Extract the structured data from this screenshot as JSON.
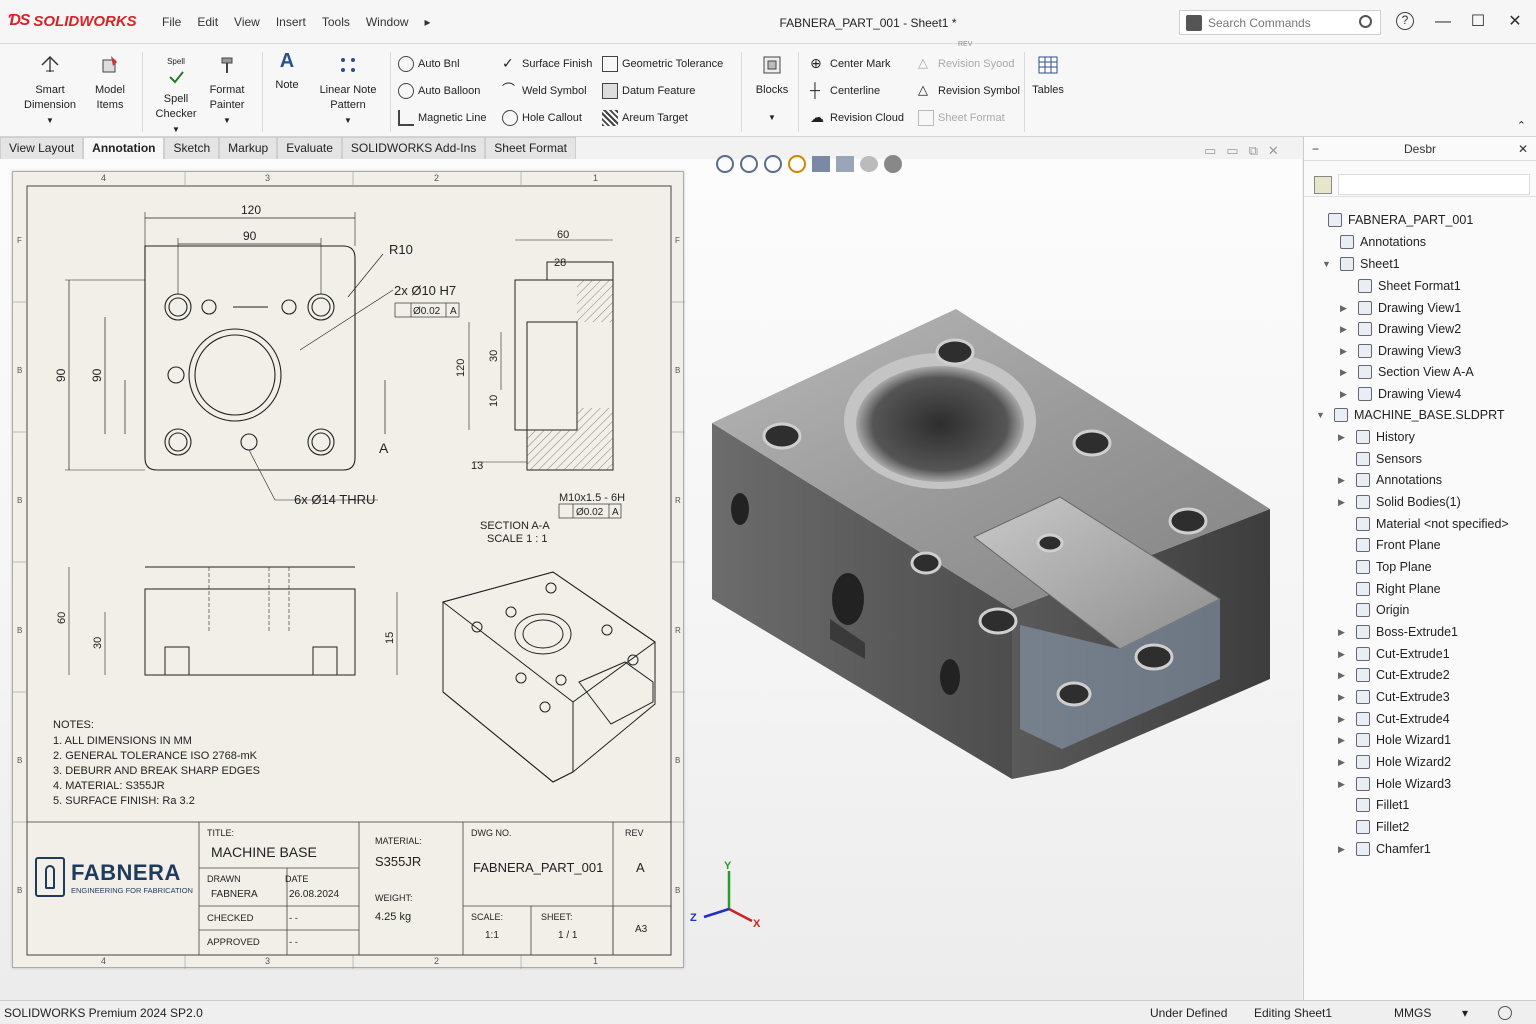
{
  "app": {
    "brand": "SOLIDWORKS",
    "doc_title": "FABNERA_PART_001 - Sheet1 *"
  },
  "menu": [
    "File",
    "Edit",
    "View",
    "Insert",
    "Tools",
    "Window"
  ],
  "search": {
    "placeholder": "Search Commands"
  },
  "ribbon": {
    "smart_dimension": [
      "Smart",
      "Dimension"
    ],
    "model_items": [
      "Model",
      "Items"
    ],
    "spell_checker": [
      "Spell",
      "Checker"
    ],
    "spell_badge": "Spell",
    "format_painter": [
      "Format",
      "Painter"
    ],
    "note": "Note",
    "linear_note_pattern": [
      "Linear Note",
      "Pattern"
    ],
    "auto_balloon_top": "Auto Bnl",
    "auto_balloon": "Auto Balloon",
    "magnetic_line": "Magnetic Line",
    "surface_finish": "Surface Finish",
    "weld_symbol": "Weld Symbol",
    "hole_callout": "Hole Callout",
    "geometric_tolerance": "Geometric Tolerance",
    "datum_feature": "Datum Feature",
    "datum_target": "Areum Target",
    "blocks": "Blocks",
    "center_mark": "Center Mark",
    "centerline": "Centerline",
    "revision_cloud": "Revision Cloud",
    "revision_symbol_disabled": "Revision Syood",
    "revision_symbol": "Revision Symbol",
    "sheet_format": "Sheet Format",
    "rev_badge": "REV",
    "tables": "Tables"
  },
  "tabs": [
    "View Layout",
    "Annotation",
    "Sketch",
    "Markup",
    "Evaluate",
    "SOLIDWORKS Add-Ins",
    "Sheet Format"
  ],
  "tree": {
    "header": "Desbr",
    "items": [
      {
        "label": "FABNERA_PART_001",
        "arrow": ""
      },
      {
        "label": "Annotations",
        "arrow": ""
      },
      {
        "label": "Sheet1",
        "arrow": "▼"
      },
      {
        "label": "Sheet Format1",
        "arrow": ""
      },
      {
        "label": "Drawing View1",
        "arrow": "▶"
      },
      {
        "label": "Drawing View2",
        "arrow": "▶"
      },
      {
        "label": "Drawing View3",
        "arrow": "▶"
      },
      {
        "label": "Section View A-A",
        "arrow": "▶"
      },
      {
        "label": "Drawing View4",
        "arrow": "▶"
      },
      {
        "label": "MACHINE_BASE.SLDPRT",
        "arrow": "▼"
      },
      {
        "label": "History",
        "arrow": "▶"
      },
      {
        "label": "Sensors",
        "arrow": ""
      },
      {
        "label": "Annotations",
        "arrow": "▶"
      },
      {
        "label": "Solid Bodies(1)",
        "arrow": "▶"
      },
      {
        "label": "Material <not specified>",
        "arrow": ""
      },
      {
        "label": "Front Plane",
        "arrow": ""
      },
      {
        "label": "Top Plane",
        "arrow": ""
      },
      {
        "label": "Right Plane",
        "arrow": ""
      },
      {
        "label": "Origin",
        "arrow": ""
      },
      {
        "label": "Boss-Extrude1",
        "arrow": "▶"
      },
      {
        "label": "Cut-Extrude1",
        "arrow": "▶"
      },
      {
        "label": "Cut-Extrude2",
        "arrow": "▶"
      },
      {
        "label": "Cut-Extrude3",
        "arrow": "▶"
      },
      {
        "label": "Cut-Extrude4",
        "arrow": "▶"
      },
      {
        "label": "Hole Wizard1",
        "arrow": "▶"
      },
      {
        "label": "Hole Wizard2",
        "arrow": "▶"
      },
      {
        "label": "Hole Wizard3",
        "arrow": "▶"
      },
      {
        "label": "Fillet1",
        "arrow": ""
      },
      {
        "label": "Fillet2",
        "arrow": ""
      },
      {
        "label": "Chamfer1",
        "arrow": "▶"
      }
    ]
  },
  "drawing": {
    "zones_top": [
      "4",
      "3",
      "2",
      "1"
    ],
    "zones_side": [
      "F",
      "B",
      "B",
      "B",
      "B",
      "B"
    ],
    "zones_side_right": [
      "F",
      "B",
      "R",
      "R",
      "B",
      "B"
    ],
    "dims": {
      "d120": "120",
      "d90": "90",
      "r10": "R10",
      "holes_h7": "2x Ø10 H7",
      "tol_pos": "Ø0.02",
      "datum_a": "A",
      "v90a": "90",
      "v90b": "90",
      "section_label": "A",
      "thru": "6x Ø14 THRU",
      "d60": "60",
      "d28": "28",
      "d30v": "30",
      "d120v": "120",
      "d13": "13",
      "d10v": "10",
      "m10": "M10x1.5 - 6H",
      "tol2": "Ø0.02",
      "section_title": "SECTION A-A",
      "section_scale": "SCALE 1 : 1",
      "f60": "60",
      "f30": "30",
      "f15": "15"
    },
    "notes_title": "NOTES:",
    "notes": [
      "1. ALL DIMENSIONS IN MM",
      "2. GENERAL TOLERANCE ISO 2768-mK",
      "3. DEBURR AND BREAK SHARP EDGES",
      "4. MATERIAL: S355JR",
      "5. SURFACE FINISH: Ra 3.2"
    ],
    "title_block": {
      "company": "FABNERA",
      "tagline": "ENGINEERING FOR FABRICATION",
      "title_label": "TITLE:",
      "title": "MACHINE BASE",
      "drawn_label": "DRAWN",
      "drawn": "FABNERA",
      "date_label": "DATE",
      "date": "26.08.2024",
      "checked_label": "CHECKED",
      "checked": "-  -",
      "approved_label": "APPROVED",
      "approved": "-  -",
      "material_label": "MATERIAL:",
      "material": "S355JR",
      "weight_label": "WEIGHT:",
      "weight": "4.25 kg",
      "dwg_label": "DWG NO.",
      "dwg": "FABNERA_PART_001",
      "rev_label": "REV",
      "rev": "A",
      "scale_label": "SCALE:",
      "scale": "1:1",
      "sheet_label": "SHEET:",
      "sheet": "1 / 1",
      "size": "A3"
    }
  },
  "axes": {
    "x": "X",
    "y": "Y",
    "z": "Z"
  },
  "status": {
    "version": "SOLIDWORKS Premium 2024 SP2.0",
    "state": "Under Defined",
    "editing": "Editing Sheet1",
    "units": "MMGS"
  }
}
